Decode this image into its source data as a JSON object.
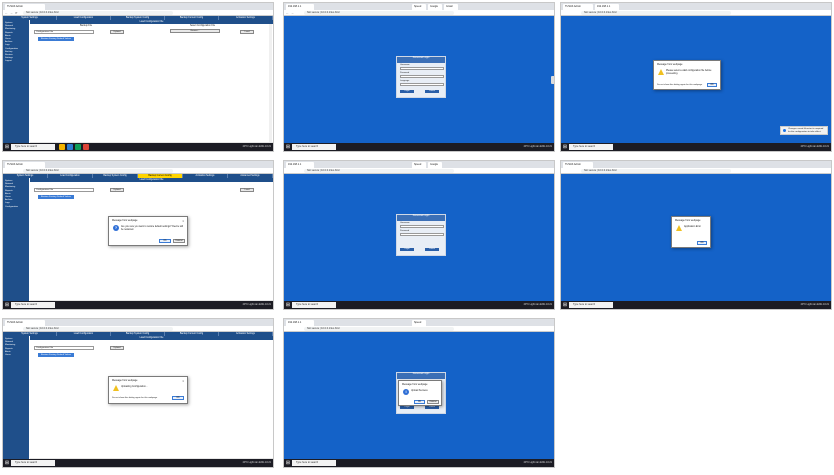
{
  "browser": {
    "tab_title": "TUSAS Admin",
    "tab_title_ip": "192.168.1.1",
    "address": "Not secure | 10.0.0.1/tus.html",
    "tabs_extra": [
      "Speed",
      "Google",
      "Gmail",
      "Jira"
    ]
  },
  "taskbar": {
    "search_placeholder": "Type here to search",
    "tray": "29°C  Light rain  ENG  10:21"
  },
  "admin": {
    "header_items": [
      "System Settings",
      "Load Configuration",
      "Backup System Config",
      "Backup Current Config",
      "Activation Settings",
      "Advanced Settings"
    ],
    "sidebar_items": [
      "System",
      "Network",
      "Monitoring",
      "Reports",
      "Alerts",
      "Users",
      "Archive",
      "Logs",
      "Configuration",
      "Backup",
      "Restore",
      "Settings",
      "Logout"
    ],
    "section_title": "Load Configuration File",
    "col_left": "Backup File",
    "col_right": "Select Configuration File",
    "select_value": "Configuration File",
    "btn_upload": "Upload",
    "btn_browse": "Browse...",
    "btn_load": "Load",
    "btn_restore": "Restore Factory Default Values"
  },
  "login": {
    "title": "Personnel Login",
    "subtitle": "User Login",
    "lbl_user": "Username",
    "lbl_pass": "Password",
    "lbl_lang": "Language",
    "btn_login": "Login",
    "btn_cancel": "Cancel"
  },
  "dialogs": {
    "title": "Message from webpage",
    "confirm_msg": "Are you sure you want to restore default settings? Device will be restarted.",
    "wait_msg": "Uploading Configuration...",
    "error_msg": "Please select a valid configuration file before proceeding.",
    "info_msg": "Upload Success",
    "final_msg": "Application Error",
    "checkbox": "Do not show this dialog again for this webpage",
    "ok": "OK",
    "cancel": "Cancel"
  },
  "toast": {
    "text": "Changes saved. A restart is required for the configuration to take effect."
  },
  "colors": {
    "header_blue": "#1f4f8a",
    "login_bg": "#1462c8",
    "highlight": "#ffd400"
  }
}
